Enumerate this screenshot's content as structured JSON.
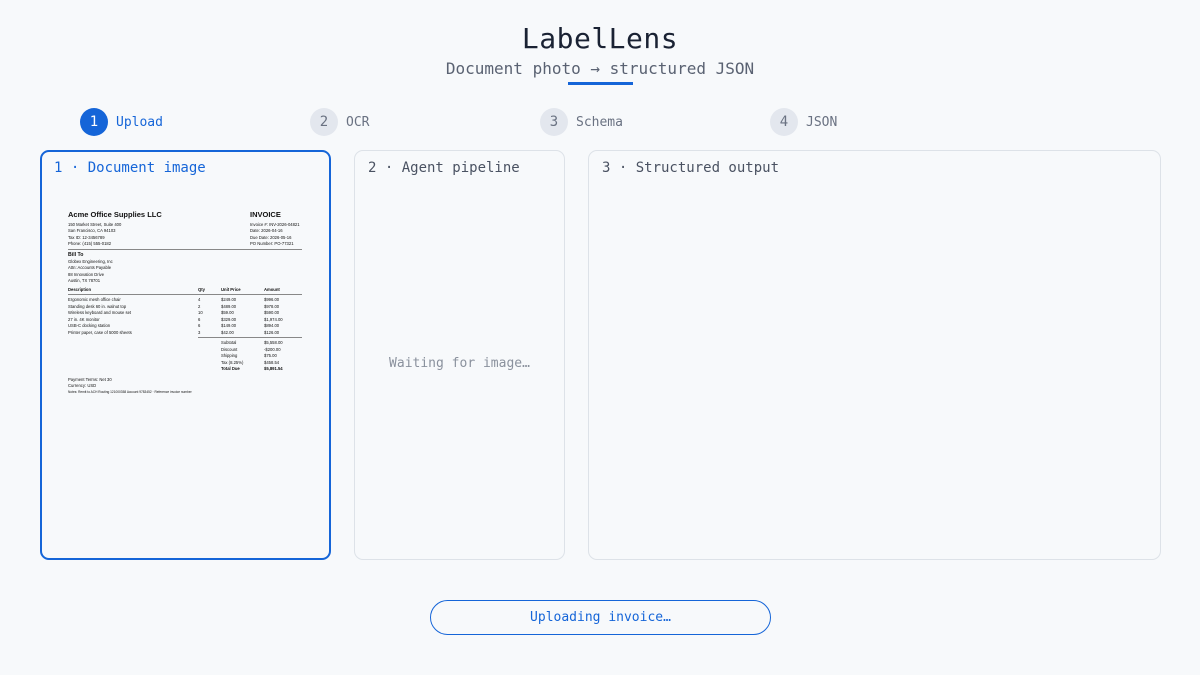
{
  "header": {
    "title": "LabelLens",
    "subtitle": "Document photo → structured JSON"
  },
  "steps": [
    {
      "num": "1",
      "label": "Upload",
      "active": true
    },
    {
      "num": "2",
      "label": "OCR",
      "active": false
    },
    {
      "num": "3",
      "label": "Schema",
      "active": false
    },
    {
      "num": "4",
      "label": "JSON",
      "active": false
    }
  ],
  "panels": {
    "document": {
      "title": "1 · Document image"
    },
    "pipeline": {
      "title": "2 · Agent pipeline",
      "placeholder": "Waiting for image…"
    },
    "output": {
      "title": "3 · Structured output"
    }
  },
  "invoice": {
    "company": "Acme Office Supplies LLC",
    "address_lines": [
      "150 Market Street, Suite 400",
      "San Francisco, CA 94103",
      "Tax ID: 12-3456789",
      "Phone: (415) 555-0182"
    ],
    "doc_title": "INVOICE",
    "meta_lines": [
      "Invoice #: INV-2026-04821",
      "Date: 2026-04-16",
      "Due Date: 2026-05-16",
      "PO Number: PO-77321"
    ],
    "bill_to_heading": "Bill To",
    "bill_to_lines": [
      "Globex Engineering, Inc",
      "Attn: Accounts Payable",
      "88 Innovation Drive",
      "Austin, TX 78701"
    ],
    "columns": [
      "Description",
      "Qty",
      "Unit Price",
      "Amount"
    ],
    "items": [
      {
        "desc": "Ergonomic mesh office chair",
        "qty": "4",
        "unit": "$249.00",
        "amount": "$996.00"
      },
      {
        "desc": "Standing desk 60 in. walnut top",
        "qty": "2",
        "unit": "$489.00",
        "amount": "$978.00"
      },
      {
        "desc": "Wireless keyboard and mouse set",
        "qty": "10",
        "unit": "$59.00",
        "amount": "$590.00"
      },
      {
        "desc": "27 in. 4K monitor",
        "qty": "6",
        "unit": "$329.00",
        "amount": "$1,974.00"
      },
      {
        "desc": "USB-C docking station",
        "qty": "6",
        "unit": "$149.00",
        "amount": "$894.00"
      },
      {
        "desc": "Printer paper, case of 5000 sheets",
        "qty": "3",
        "unit": "$42.00",
        "amount": "$126.00"
      }
    ],
    "totals": [
      {
        "label": "Subtotal",
        "value": "$5,558.00",
        "bold": false
      },
      {
        "label": "Discount",
        "value": "-$200.00",
        "bold": false
      },
      {
        "label": "Shipping",
        "value": "$75.00",
        "bold": false
      },
      {
        "label": "Tax (8.25%)",
        "value": "$458.54",
        "bold": false
      },
      {
        "label": "Total Due",
        "value": "$5,891.54",
        "bold": true
      }
    ],
    "payment_terms": "Payment Terms: Net 30",
    "currency": "Currency: USD",
    "notes": "Notes: Remit to ACH Routing 121000358 Account 9783452 · Reference invoice number"
  },
  "status": {
    "label": "Uploading invoice…"
  },
  "colors": {
    "accent": "#1565d8",
    "background": "#f7f9fb",
    "border": "#dde2e8"
  }
}
